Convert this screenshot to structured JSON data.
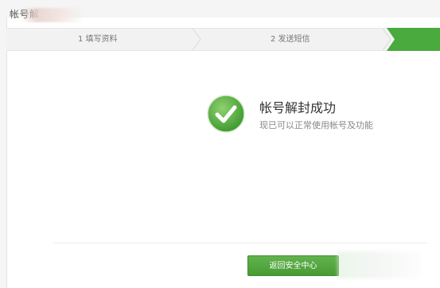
{
  "page": {
    "title": "帐号解"
  },
  "steps": [
    {
      "label": "1 填写资料",
      "state": "done"
    },
    {
      "label": "2 发送短信",
      "state": "done"
    },
    {
      "label": "",
      "state": "active"
    }
  ],
  "success": {
    "title": "帐号解封成功",
    "subtitle": "现已可以正常使用帐号及功能",
    "icon": "check-circle-icon"
  },
  "actions": {
    "back_label": "返回安全中心"
  },
  "colors": {
    "accent_green": "#4caf50",
    "button_green": "#56a845",
    "active_step_green": "#4aaa3d"
  }
}
